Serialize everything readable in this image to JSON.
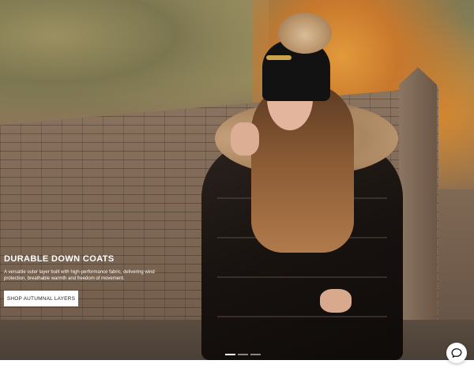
{
  "hero": {
    "title": "DURABLE DOWN COATS",
    "description": "A versatile outer layer built with high-performance fabric, delivering wind protection, breathable warmth and freedom of movement.",
    "cta_label": "SHOP AUTUMNAL LAYERS",
    "slides": [
      "slide-1",
      "slide-2",
      "slide-3"
    ],
    "active_slide": 1
  },
  "chat": {
    "icon": "chat-bubble-icon"
  },
  "colors": {
    "cta_background": "#ffffff",
    "hero_text": "#ffffff"
  }
}
